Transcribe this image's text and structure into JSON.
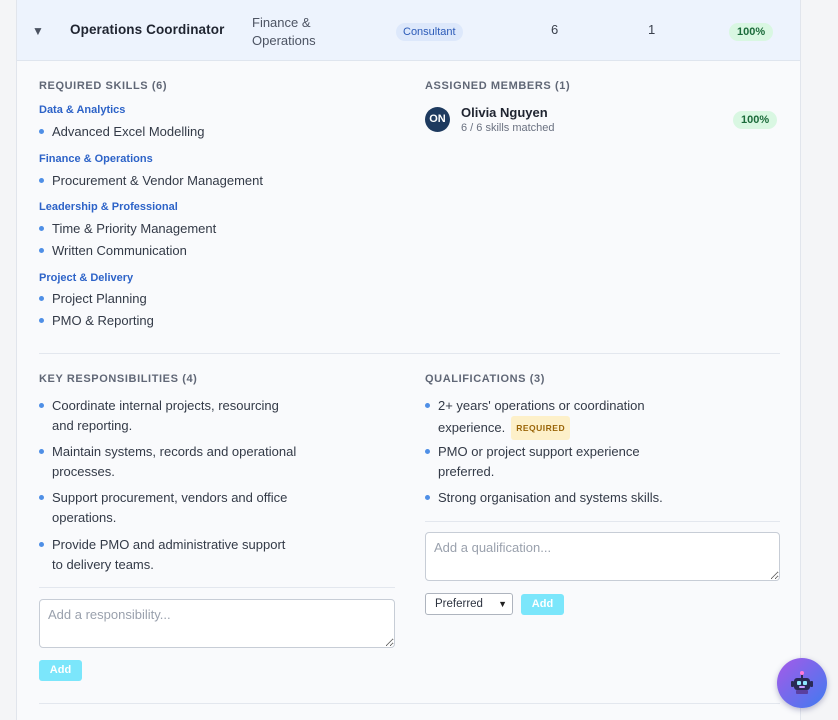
{
  "role_row": {
    "expand_icon": "triangle-down",
    "title": "Operations Coordinator",
    "department": "Finance & Operations",
    "type_badge": "Consultant",
    "skills_count": "6",
    "members_count": "1",
    "coverage": "100%"
  },
  "required_skills": {
    "title": "REQUIRED SKILLS (6)",
    "categories": [
      {
        "name": "Data & Analytics",
        "items": [
          "Advanced Excel Modelling"
        ]
      },
      {
        "name": "Finance & Operations",
        "items": [
          "Procurement & Vendor Management"
        ]
      },
      {
        "name": "Leadership & Professional",
        "items": [
          "Time & Priority Management",
          "Written Communication"
        ]
      },
      {
        "name": "Project & Delivery",
        "items": [
          "Project Planning",
          "PMO & Reporting"
        ]
      }
    ]
  },
  "assigned_members": {
    "title": "ASSIGNED MEMBERS (1)",
    "members": [
      {
        "initials": "ON",
        "name": "Olivia Nguyen",
        "skills_matched": "6 / 6 skills matched",
        "coverage": "100%"
      }
    ]
  },
  "responsibilities": {
    "title": "KEY RESPONSIBILITIES (4)",
    "items": [
      [
        "Coordinate internal projects, resourcing",
        "and reporting."
      ],
      [
        "Maintain systems, records and operational",
        "processes."
      ],
      [
        "Support procurement, vendors and office",
        "operations."
      ],
      [
        "Provide PMO and administrative support",
        "to delivery teams."
      ]
    ],
    "input_placeholder": "Add a responsibility...",
    "add_label": "Add"
  },
  "qualifications": {
    "title": "QUALIFICATIONS (3)",
    "items": [
      {
        "lines": [
          "2+ years' operations or coordination",
          "experience."
        ],
        "tag": "REQUIRED"
      },
      {
        "lines": [
          "PMO or project support experience",
          "preferred."
        ],
        "tag": ""
      },
      {
        "lines": [
          "Strong organisation and systems skills."
        ],
        "tag": ""
      }
    ],
    "input_placeholder": "Add a qualification...",
    "type_select_value": "Preferred",
    "add_label": "Add"
  },
  "colors": {
    "accent": "#2d63c8",
    "bullet": "#4f8fe6",
    "header_bg": "#edf3fd",
    "coverage_badge": "#d9f7e2",
    "add_button": "#7be6fb",
    "required_tag": "#fdf0c9",
    "avatar": "#1e3a5f"
  },
  "icons": {
    "expand": "chevron-down-icon",
    "assistant": "robot-assistant-icon"
  }
}
